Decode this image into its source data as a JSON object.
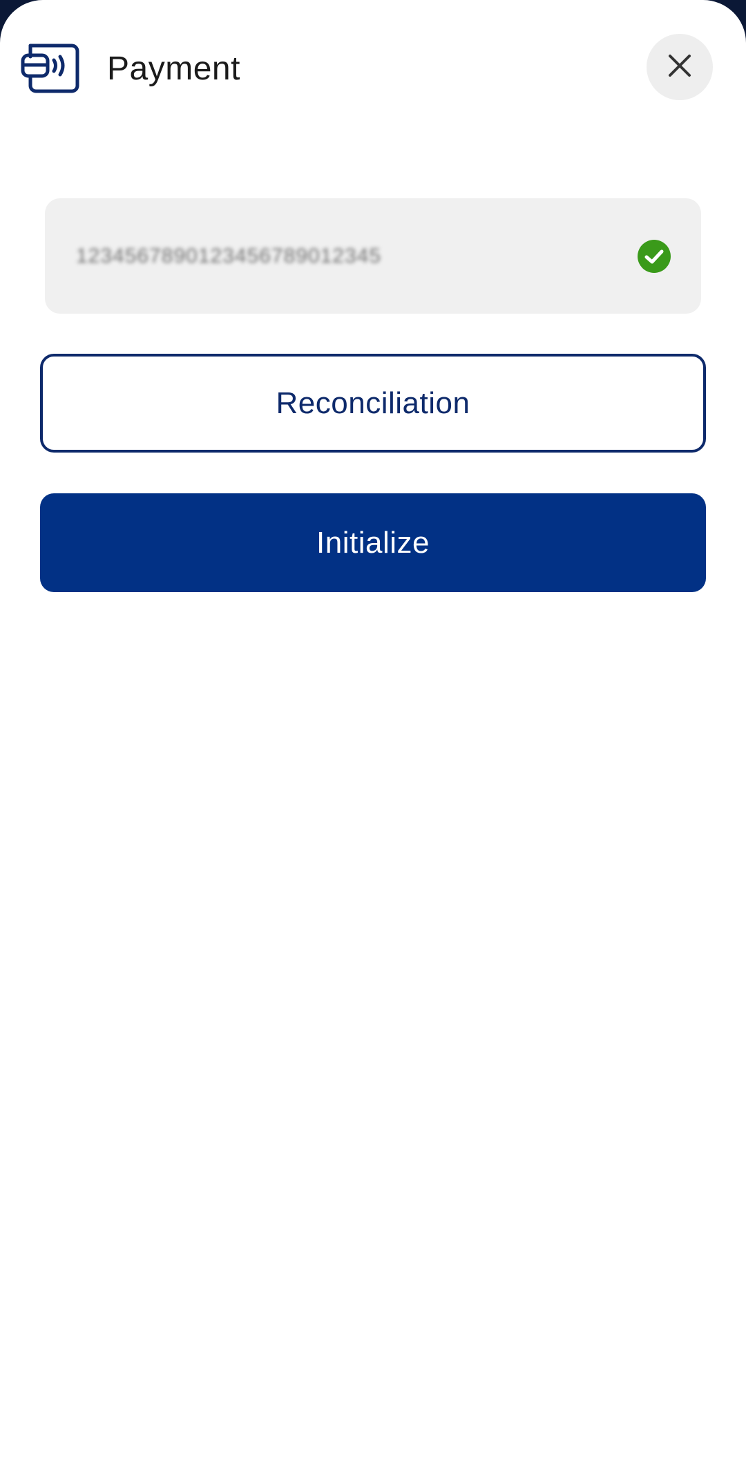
{
  "header": {
    "title": "Payment",
    "icon": "contactless-card-icon",
    "close_icon": "close-icon"
  },
  "device_field": {
    "value": "1234567890123456789012345",
    "status_icon": "check-circle-icon"
  },
  "buttons": {
    "reconciliation_label": "Reconciliation",
    "initialize_label": "Initialize"
  },
  "colors": {
    "brand": "#023185",
    "outline": "#0e2a6b",
    "success": "#3a9a1a",
    "field_bg": "#f0f0f0"
  }
}
